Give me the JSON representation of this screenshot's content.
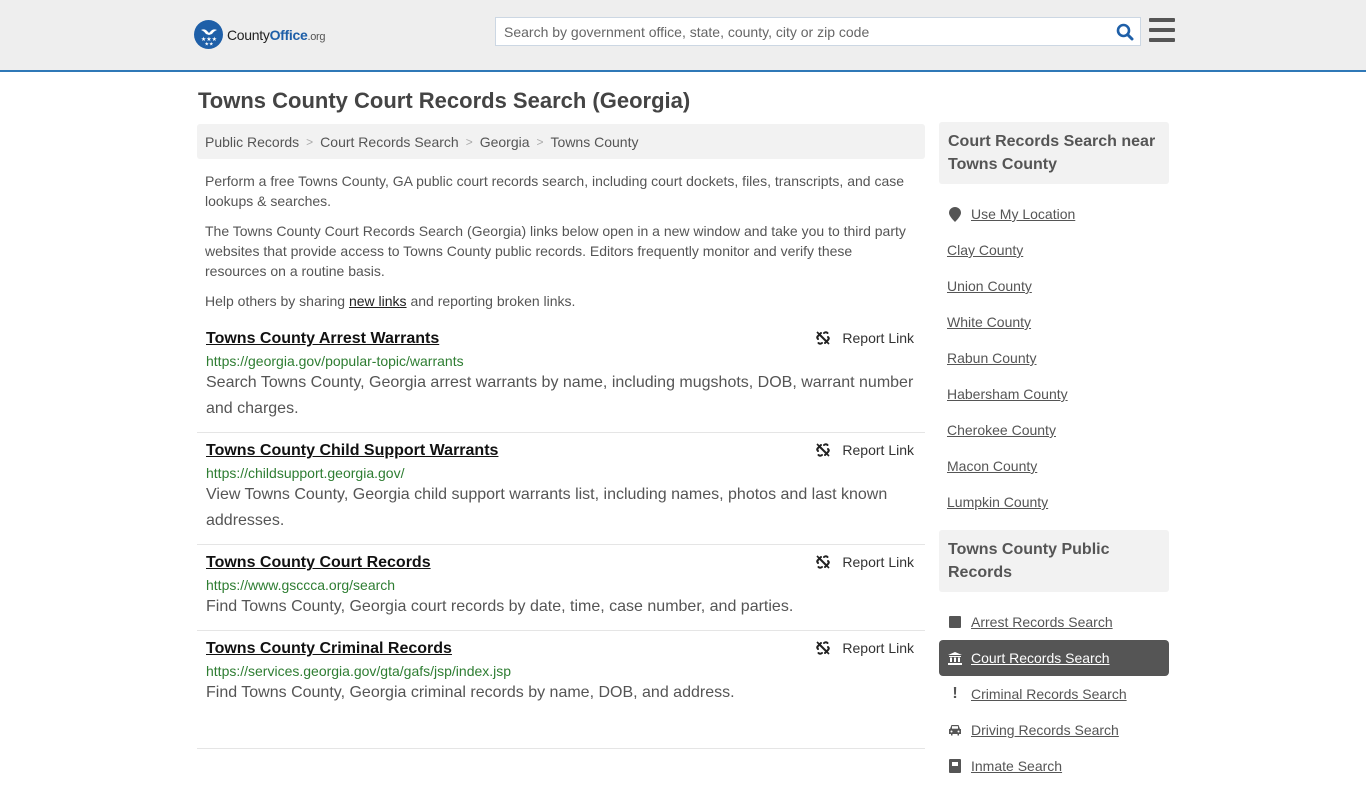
{
  "header": {
    "logo": {
      "part1": "County",
      "part2": "Office",
      "part3": ".org"
    },
    "search": {
      "placeholder": "Search by government office, state, county, city or zip code",
      "value": ""
    },
    "icons": {
      "search": "search-icon",
      "menu": "hamburger-menu-icon"
    }
  },
  "page": {
    "title": "Towns County Court Records Search (Georgia)"
  },
  "breadcrumb": [
    {
      "label": "Public Records"
    },
    {
      "label": "Court Records Search"
    },
    {
      "label": "Georgia"
    },
    {
      "label": "Towns County"
    }
  ],
  "intro": {
    "p1": "Perform a free Towns County, GA public court records search, including court dockets, files, transcripts, and case lookups & searches.",
    "p2": "The Towns County Court Records Search (Georgia) links below open in a new window and take you to third party websites that provide access to Towns County public records. Editors frequently monitor and verify these resources on a routine basis.",
    "p3_before": "Help others by sharing ",
    "p3_link": "new links",
    "p3_after": " and reporting broken links."
  },
  "results": [
    {
      "title": "Towns County Arrest Warrants",
      "url": "https://georgia.gov/popular-topic/warrants",
      "description": "Search Towns County, Georgia arrest warrants by name, including mugshots, DOB, warrant number and charges.",
      "report_label": "Report Link"
    },
    {
      "title": "Towns County Child Support Warrants",
      "url": "https://childsupport.georgia.gov/",
      "description": "View Towns County, Georgia child support warrants list, including names, photos and last known addresses.",
      "report_label": "Report Link"
    },
    {
      "title": "Towns County Court Records",
      "url": "https://www.gsccca.org/search",
      "description": "Find Towns County, Georgia court records by date, time, case number, and parties.",
      "report_label": "Report Link"
    },
    {
      "title": "Towns County Criminal Records",
      "url": "https://services.georgia.gov/gta/gafs/jsp/index.jsp",
      "description": "Find Towns County, Georgia criminal records by name, DOB, and address.",
      "report_label": "Report Link"
    }
  ],
  "sidebar": {
    "nearby": {
      "heading": "Court Records Search near Towns County",
      "use_location": "Use My Location",
      "items": [
        "Clay County",
        "Union County",
        "White County",
        "Rabun County",
        "Habersham County",
        "Cherokee County",
        "Macon County",
        "Lumpkin County"
      ]
    },
    "public_records": {
      "heading": "Towns County Public Records",
      "items": [
        {
          "label": "Arrest Records Search",
          "icon": "square-icon",
          "active": false
        },
        {
          "label": "Court Records Search",
          "icon": "courthouse-icon",
          "active": true
        },
        {
          "label": "Criminal Records Search",
          "icon": "exclamation-icon",
          "active": false
        },
        {
          "label": "Driving Records Search",
          "icon": "car-icon",
          "active": false
        },
        {
          "label": "Inmate Search",
          "icon": "id-card-icon",
          "active": false
        }
      ]
    }
  },
  "colors": {
    "brand_blue": "#1e5fa8",
    "header_border": "#2f78b7",
    "url_green": "#2e7d32",
    "active_bg": "#555555"
  }
}
